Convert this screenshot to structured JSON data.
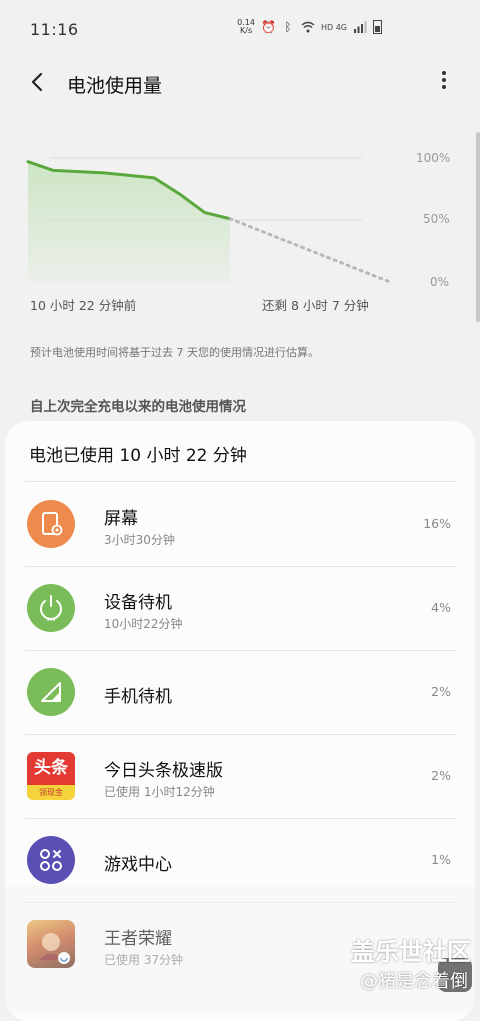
{
  "status_bar": {
    "time": "11:16",
    "net_speed": "0.14",
    "net_unit": "K/s",
    "network": "HD 4G"
  },
  "app_bar": {
    "title": "电池使用量"
  },
  "chart_data": {
    "type": "area",
    "y_ticks": [
      "100%",
      "50%",
      "0%"
    ],
    "ylim": [
      0,
      100
    ],
    "x_start_label": "10 小时 22 分钟前",
    "x_end_label": "还剩 8 小时 7 分钟",
    "series": [
      {
        "values": [
          97,
          90,
          89,
          88,
          86,
          84,
          71,
          56,
          51
        ]
      }
    ],
    "projection": [
      51,
      0
    ],
    "colors": {
      "line": "#5aa83c",
      "fill": "#c9e4bf",
      "projection": "#b8b8b8",
      "grid": "#dcdcdc"
    }
  },
  "note": "预计电池使用时间将基于过去 7 天您的使用情况进行估算。",
  "section_header": "自上次完全充电以来的电池使用情况",
  "usage": {
    "title": "电池已使用 10 小时 22 分钟",
    "items": [
      {
        "name": "屏幕",
        "sub": "3小时30分钟",
        "pct": "16%",
        "icon": "screen-icon",
        "color": "#ee8a4d"
      },
      {
        "name": "设备待机",
        "sub": "10小时22分钟",
        "pct": "4%",
        "icon": "power-icon",
        "color": "#79bc59"
      },
      {
        "name": "手机待机",
        "sub": "",
        "pct": "2%",
        "icon": "signal-icon",
        "color": "#79bc59"
      },
      {
        "name": "今日头条极速版",
        "sub": "已使用 1小时12分钟",
        "pct": "2%",
        "icon": "toutiao-icon",
        "color": "#e23a32",
        "logo_text": "头条",
        "logo_sub": "领现金"
      },
      {
        "name": "游戏中心",
        "sub": "",
        "pct": "1%",
        "icon": "game-center-icon",
        "color": "#5a4fb3"
      },
      {
        "name": "王者荣耀",
        "sub": "已使用 37分钟",
        "pct": "",
        "icon": "honor-of-kings-icon",
        "color": "#c65a2a"
      }
    ]
  },
  "watermark": {
    "line1": "盖乐世社区",
    "line2": "@猪是念着倒"
  }
}
